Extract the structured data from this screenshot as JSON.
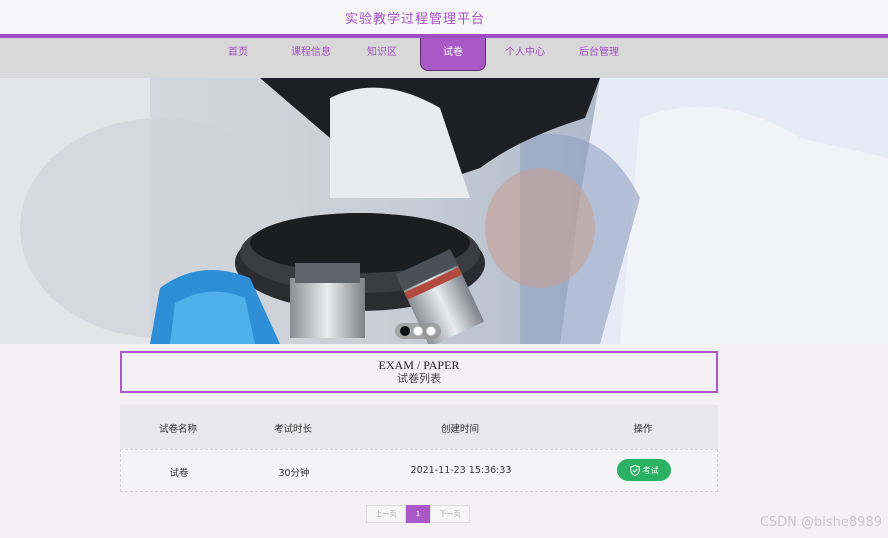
{
  "header": {
    "title": "实验教学过程管理平台"
  },
  "nav": {
    "items": [
      {
        "label": "首页",
        "active": false
      },
      {
        "label": "课程信息",
        "active": false
      },
      {
        "label": "知识区",
        "active": false
      },
      {
        "label": "试卷",
        "active": true
      },
      {
        "label": "个人中心",
        "active": false
      },
      {
        "label": "后台管理",
        "active": false
      }
    ]
  },
  "carousel": {
    "active_index": 0,
    "count": 3
  },
  "section": {
    "title_en": "EXAM / PAPER",
    "title_cn": "试卷列表"
  },
  "table": {
    "headers": [
      "试卷名称",
      "考试时长",
      "创建时间",
      "操作"
    ],
    "rows": [
      {
        "name": "试卷",
        "duration": "30分钟",
        "created": "2021-11-23 15:36:33",
        "action": "考试"
      }
    ]
  },
  "pagination": {
    "prev": "上一页",
    "current": "1",
    "next": "下一页"
  },
  "watermark": "CSDN @bishe8989",
  "colors": {
    "accent": "#a958c8",
    "exam_button": "#2bb163"
  }
}
